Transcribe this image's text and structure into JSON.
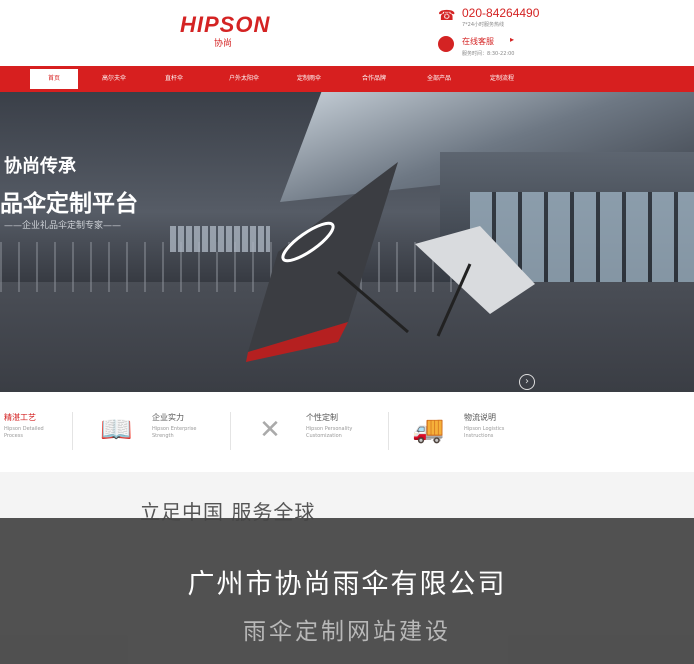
{
  "header": {
    "logo_text": "HIPSON",
    "logo_sub": "协尚",
    "phone_number": "020-84264490",
    "phone_note": "7*24小时服务热线",
    "chat_label": "在线客服",
    "chat_arrow": "▸",
    "chat_hours": "服务时间：8:30-22:00"
  },
  "nav": {
    "items": [
      "",
      "首页",
      "高尔夫伞",
      "直杆伞",
      "户外太阳伞",
      "定制雨伞",
      "合作品牌",
      "全部产品",
      "定制流程"
    ]
  },
  "hero": {
    "headline": "协尚传承",
    "title": "品伞定制平台",
    "tagline": "——企业礼品伞定制专家——",
    "next_icon": "›"
  },
  "features": [
    {
      "name": "精湛工艺",
      "en": "Hipson Detailed\nProcess",
      "icon": "precision-icon"
    },
    {
      "name": "企业实力",
      "en": "Hipson Enterprise\nStrength",
      "icon": "book-icon"
    },
    {
      "name": "个性定制",
      "en": "Hipson Personality\nCustomization",
      "icon": "tools-icon"
    },
    {
      "name": "物流说明",
      "en": "Hipson Logistics\nInstructions",
      "icon": "truck-icon"
    }
  ],
  "slogan": "立足中国 服务全球",
  "overlay": {
    "title": "广州市协尚雨伞有限公司",
    "subtitle": "雨伞定制网站建设"
  },
  "colors": {
    "brand_red": "#d71f1f",
    "overlay_bg": "#444444",
    "overlay_title": "#ffffff",
    "overlay_sub": "#b8b8b8"
  }
}
